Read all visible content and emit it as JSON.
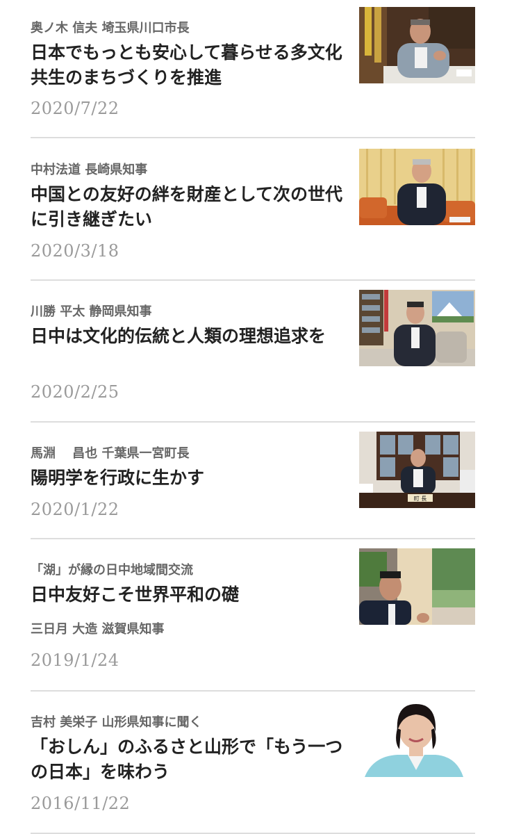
{
  "articles": [
    {
      "kicker": "奥ノ木 信夫 埼玉県川口市長",
      "title": "日本でもっとも安心して暮らせる多文化共生のまちづくりを推進",
      "date": "2020/7/22",
      "photo_alt": "奥ノ木 信夫 市長 インタビュー写真"
    },
    {
      "kicker": "中村法道 長崎県知事",
      "title": "中国との友好の絆を財産として次の世代に引き継ぎたい",
      "date": "2020/3/18",
      "photo_alt": "中村法道 知事 インタビュー写真"
    },
    {
      "kicker": "川勝 平太 静岡県知事",
      "title": "日中は文化的伝統と人類の理想追求を",
      "date": "2020/2/25",
      "photo_alt": "川勝 平太 知事 インタビュー写真"
    },
    {
      "kicker": "馬淵　 昌也 千葉県一宮町長",
      "title": "陽明学を行政に生かす",
      "date": "2020/1/22",
      "photo_alt": "馬淵 昌也 町長 インタビュー写真",
      "nameplate": "町 長"
    },
    {
      "kicker": "「湖」が縁の日中地域間交流",
      "title": "日中友好こそ世界平和の礎",
      "subtitle": "三日月 大造 滋賀県知事",
      "date": "2019/1/24",
      "photo_alt": "三日月 大造 知事 インタビュー写真"
    },
    {
      "kicker": "吉村 美栄子 山形県知事に聞く",
      "title": "「おしん」のふるさと山形で「もう一つの日本」を味わう",
      "date": "2016/11/22",
      "photo_alt": "吉村 美栄子 知事 写真"
    }
  ]
}
